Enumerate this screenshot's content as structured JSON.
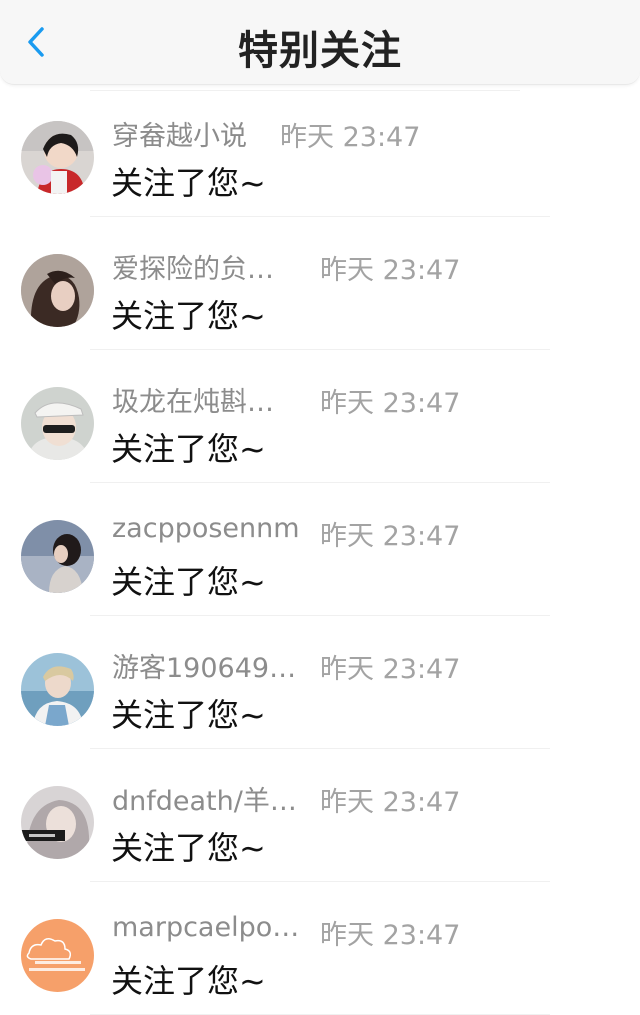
{
  "header": {
    "title": "特别关注",
    "back_icon": "chevron-left-icon",
    "accent_color": "#1a9bf0"
  },
  "notifications": [
    {
      "name": "穿畚越小说",
      "time": "昨天 23:47",
      "action": "关注了您~"
    },
    {
      "name": "爱探险的贠…",
      "time": "昨天 23:47",
      "action": "关注了您~"
    },
    {
      "name": "圾龙在炖斟…",
      "time": "昨天 23:47",
      "action": "关注了您~"
    },
    {
      "name": "zacpposennm",
      "time": "昨天 23:47",
      "action": "关注了您~"
    },
    {
      "name": "游客190649…",
      "time": "昨天 23:47",
      "action": "关注了您~"
    },
    {
      "name": "dnfdeath/羊…",
      "time": "昨天 23:47",
      "action": "关注了您~"
    },
    {
      "name": "marpcaelpo…",
      "time": "昨天 23:47",
      "action": "关注了您~"
    }
  ]
}
